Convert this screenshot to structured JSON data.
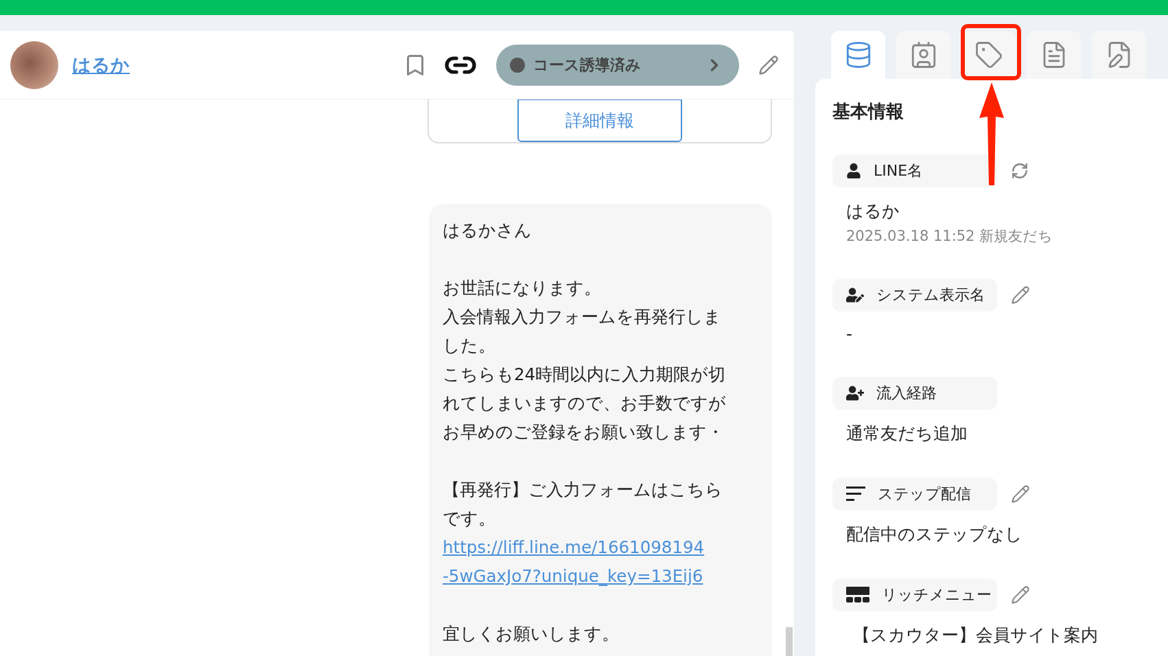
{
  "header": {
    "name": "はるか",
    "status": {
      "label": "コース誘導済み"
    }
  },
  "detail_button": "詳細情報",
  "message": {
    "blocks": [
      {
        "kind": "text",
        "lines": [
          "はるかさん"
        ]
      },
      {
        "kind": "text",
        "lines": [
          "お世話になります。",
          "入会情報入力フォームを再発行しま",
          "した。",
          "こちらも24時間以内に入力期限が切",
          "れてしまいますので、お手数ですが",
          "お早めのご登録をお願い致します・"
        ]
      },
      {
        "kind": "text",
        "lines": [
          "【再発行】ご入力フォームはこちら",
          "です。"
        ]
      },
      {
        "kind": "link",
        "lines": [
          "https://liff.line.me/1661098194",
          "-5wGaxJo7?unique_key=13Eij6"
        ]
      },
      {
        "kind": "text",
        "lines": [
          "宜しくお願いします。"
        ]
      }
    ]
  },
  "tabs": [
    {
      "selected": true
    },
    {
      "selected": false
    },
    {
      "selected": false
    },
    {
      "selected": false
    },
    {
      "selected": false
    }
  ],
  "panel": {
    "title": "基本情報",
    "fields": [
      {
        "label": "LINE名",
        "value": "はるか",
        "sub": "2025.03.18 11:52 新規友だち"
      },
      {
        "label": "システム表示名",
        "value": "-"
      },
      {
        "label": "流入経路",
        "value": "通常友だち追加"
      },
      {
        "label": "ステップ配信",
        "value": "配信中のステップなし"
      },
      {
        "label": "リッチメニュー",
        "value": "【スカウター】会員サイト案内"
      }
    ]
  }
}
